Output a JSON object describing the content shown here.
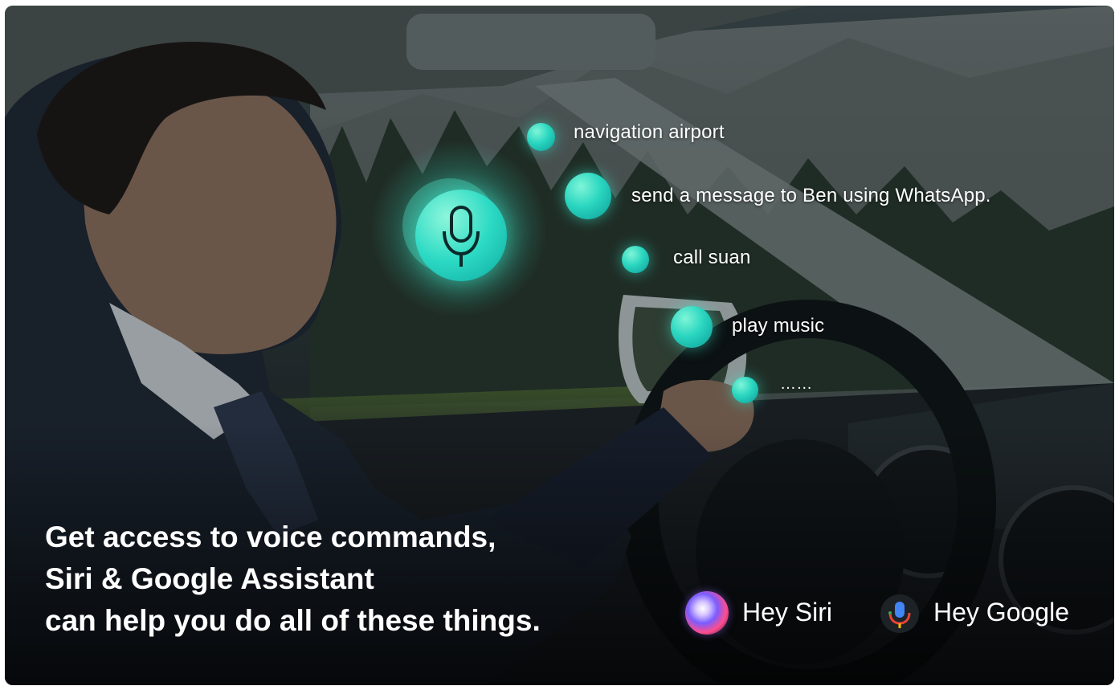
{
  "voice_commands": [
    {
      "label": "navigation airport"
    },
    {
      "label": "send a message to Ben using WhatsApp."
    },
    {
      "label": "call suan"
    },
    {
      "label": "play music"
    },
    {
      "label": "……"
    }
  ],
  "headline": {
    "line1": "Get access to voice commands,",
    "line2": "Siri & Google Assistant",
    "line3": "can help you do all of these things."
  },
  "assistants": {
    "siri": {
      "label": "Hey Siri",
      "icon": "siri-icon"
    },
    "google": {
      "label": "Hey Google",
      "icon": "google-assistant-mic-icon"
    }
  },
  "colors": {
    "accent": "#2ad6c0",
    "text": "#ffffff"
  }
}
